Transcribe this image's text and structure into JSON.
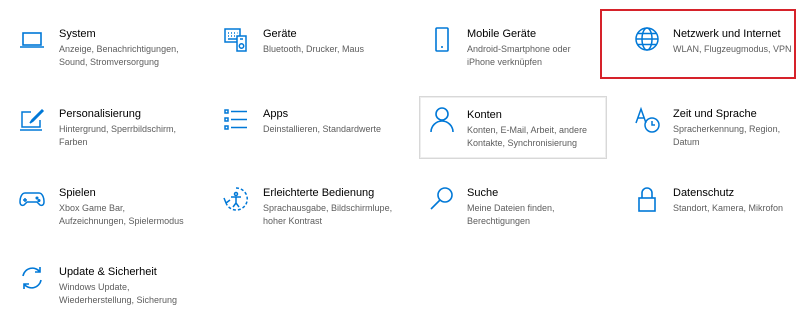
{
  "accent": "#0078d7",
  "highlight_color": "#d6222a",
  "items": [
    {
      "key": "system",
      "icon": "laptop-icon",
      "title": "System",
      "desc": [
        "Anzeige, Benachrichtigungen,",
        "Sound, Stromversorgung"
      ]
    },
    {
      "key": "devices",
      "icon": "keyboard-icon",
      "title": "Geräte",
      "desc": [
        "Bluetooth, Drucker, Maus"
      ]
    },
    {
      "key": "mobile",
      "icon": "phone-icon",
      "title": "Mobile Geräte",
      "desc": [
        "Android-Smartphone oder",
        "iPhone verknüpfen"
      ]
    },
    {
      "key": "network",
      "icon": "globe-icon",
      "title": "Netzwerk und Internet",
      "desc": [
        "WLAN, Flugzeugmodus, VPN"
      ]
    },
    {
      "key": "personalization",
      "icon": "paint-icon",
      "title": "Personalisierung",
      "desc": [
        "Hintergrund, Sperrbildschirm,",
        "Farben"
      ]
    },
    {
      "key": "apps",
      "icon": "apps-list-icon",
      "title": "Apps",
      "desc": [
        "Deinstallieren, Standardwerte"
      ]
    },
    {
      "key": "accounts",
      "icon": "person-icon",
      "title": "Konten",
      "desc": [
        "Konten, E-Mail, Arbeit, andere",
        "Kontakte, Synchronisierung"
      ]
    },
    {
      "key": "time",
      "icon": "time-language-icon",
      "title": "Zeit und Sprache",
      "desc": [
        "Spracherkennung, Region,",
        "Datum"
      ]
    },
    {
      "key": "gaming",
      "icon": "gamepad-icon",
      "title": "Spielen",
      "desc": [
        "Xbox Game Bar,",
        "Aufzeichnungen, Spielermodus"
      ]
    },
    {
      "key": "ease",
      "icon": "accessibility-icon",
      "title": "Erleichterte Bedienung",
      "desc": [
        "Sprachausgabe, Bildschirmlupe,",
        "hoher Kontrast"
      ]
    },
    {
      "key": "search",
      "icon": "search-icon",
      "title": "Suche",
      "desc": [
        "Meine Dateien finden,",
        "Berechtigungen"
      ]
    },
    {
      "key": "privacy",
      "icon": "lock-icon",
      "title": "Datenschutz",
      "desc": [
        "Standort, Kamera, Mikrofon"
      ]
    },
    {
      "key": "update",
      "icon": "sync-icon",
      "title": "Update & Sicherheit",
      "desc": [
        "Windows Update,",
        "Wiederherstellung, Sicherung"
      ]
    }
  ]
}
